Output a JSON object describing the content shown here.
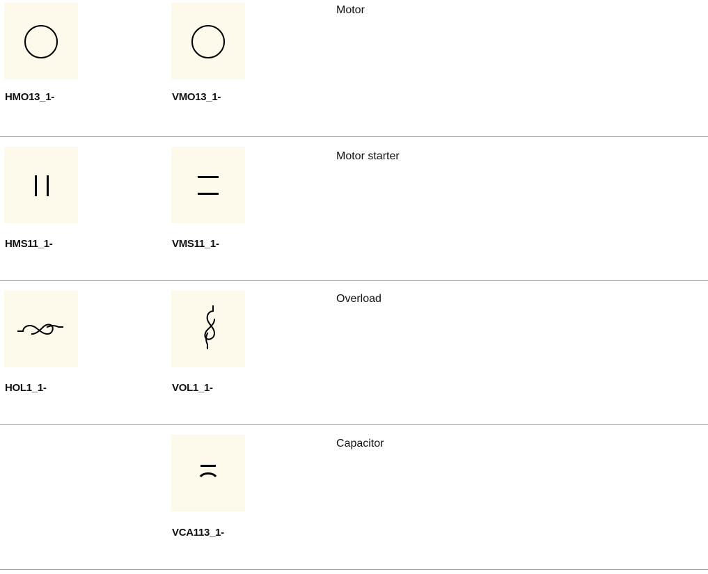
{
  "rows": [
    {
      "description": "Motor",
      "horizontal": {
        "code": "HMO13_1-",
        "icon": "motor-circle-icon"
      },
      "vertical": {
        "code": "VMO13_1-",
        "icon": "motor-circle-icon"
      }
    },
    {
      "description": "Motor starter",
      "horizontal": {
        "code": "HMS11_1-",
        "icon": "motor-starter-vertical-bars-icon"
      },
      "vertical": {
        "code": "VMS11_1-",
        "icon": "motor-starter-horizontal-bars-icon"
      }
    },
    {
      "description": "Overload",
      "horizontal": {
        "code": "HOL1_1-",
        "icon": "overload-horizontal-icon"
      },
      "vertical": {
        "code": "VOL1_1-",
        "icon": "overload-vertical-icon"
      }
    },
    {
      "description": "Capacitor",
      "horizontal": null,
      "vertical": {
        "code": "VCA113_1-",
        "icon": "capacitor-icon"
      }
    }
  ],
  "colors": {
    "tile_background": "#fdfaec",
    "divider": "#a6a6a6",
    "symbol": "#000000"
  }
}
